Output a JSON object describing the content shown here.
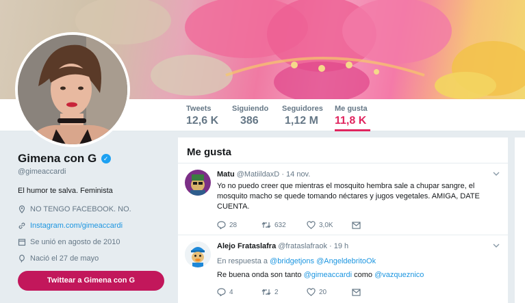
{
  "nav": {
    "stats": [
      {
        "label": "Tweets",
        "value": "12,6 K"
      },
      {
        "label": "Siguiendo",
        "value": "386"
      },
      {
        "label": "Seguidores",
        "value": "1,12 M"
      },
      {
        "label": "Me gusta",
        "value": "11,8 K"
      }
    ],
    "active": "Me gusta"
  },
  "profile": {
    "name": "Gimena con G",
    "handle": "@gimeaccardi",
    "bio": "El humor te salva. Feminista",
    "location": "NO TENGO FACEBOOK. NO.",
    "website": "Instagram.com/gimeaccardi",
    "joined": "Se unió en agosto de 2010",
    "birthday": "Nació el 27 de mayo",
    "tweet_button": "Twittear a Gimena con G"
  },
  "timeline": {
    "title": "Me gusta",
    "tweets": [
      {
        "name": "Matu",
        "handle": "@MatiildaxD",
        "time": "· 14 nov.",
        "text": "Yo no puedo creer que mientras el mosquito hembra sale a chupar sangre, el mosquito macho se quede tomando néctares y jugos vegetales. AMIGA, DATE CUENTA.",
        "replies": "28",
        "retweets": "632",
        "likes": "3,0K"
      },
      {
        "name": "Alejo Frataslafra",
        "handle": "@frataslafraok",
        "time": "· 19 h",
        "reply_prefix": "En respuesta a",
        "reply_to_1": "@bridgetjons",
        "reply_to_2": "@AngeldebritoOk",
        "text_a": "Re buena onda son tanto",
        "mention_a": "@gimeaccardi",
        "text_b": "como",
        "mention_b": "@vazqueznico",
        "replies": "4",
        "retweets": "2",
        "likes": "20"
      }
    ]
  },
  "colors": {
    "accent": "#e0245e",
    "button": "#c2175b",
    "link": "#1b95e0",
    "verified": "#1da1f2"
  }
}
